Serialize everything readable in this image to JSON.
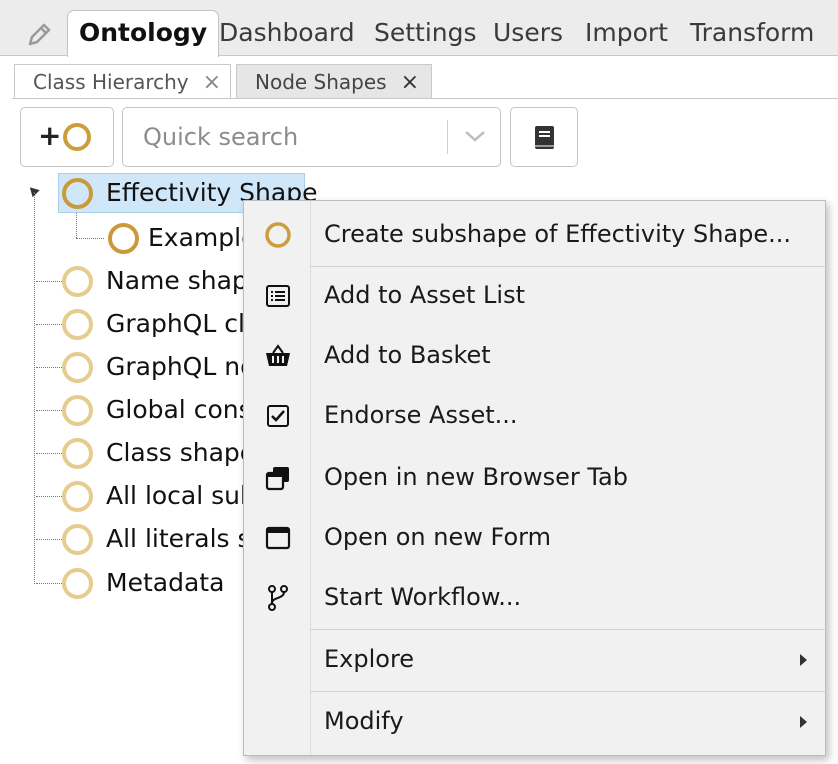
{
  "top_tabs": {
    "ontology": "Ontology",
    "dashboard": "Dashboard",
    "settings": "Settings",
    "users": "Users",
    "import": "Import",
    "transform": "Transform"
  },
  "sub_tabs": {
    "class_hierarchy": "Class Hierarchy",
    "node_shapes": "Node Shapes",
    "close_glyph": "×"
  },
  "toolbar": {
    "add_symbol": "+",
    "search_placeholder": "Quick search"
  },
  "tree": {
    "nodes": [
      "Effectivity Shape",
      "Example",
      "Name shape",
      "GraphQL cla",
      "GraphQL no",
      "Global cons",
      "Class shape",
      "All local sub",
      "All literals sh",
      "Metadata"
    ]
  },
  "context_menu": {
    "items": [
      "Create subshape of Effectivity Shape...",
      "Add to Asset List",
      "Add to Basket",
      "Endorse Asset...",
      "Open in new Browser Tab",
      "Open on new Form",
      "Start Workflow...",
      "Explore",
      "Modify"
    ]
  },
  "colors": {
    "ring_dark": "#c99a3a",
    "ring_light": "#e6cc8e",
    "selection_bg": "#cfe7f8",
    "menu_bg": "#f1f1f1"
  },
  "icons": [
    "pencil-icon",
    "close-icon",
    "circle-icon",
    "chevron-down-icon",
    "book-icon",
    "list-icon",
    "basket-icon",
    "checkbox-icon",
    "new-tab-icon",
    "form-window-icon",
    "branch-icon",
    "submenu-arrow-icon"
  ]
}
